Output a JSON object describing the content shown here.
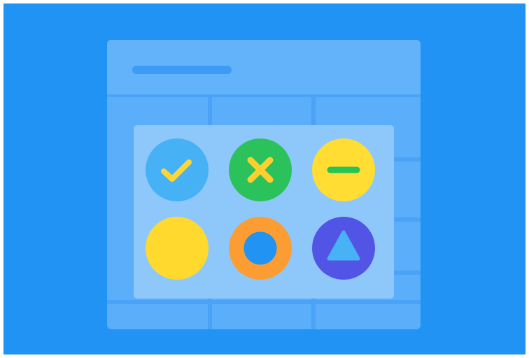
{
  "colors": {
    "frame": "#ffffff",
    "background": "#2093f4",
    "card": "#5aaefa",
    "card_header": "#63b3fb",
    "grid_lines": "#4aa3f7",
    "header_bar": "#3d9bf5",
    "panel": "#8ec8fb"
  },
  "status_icons": [
    {
      "name": "check-icon",
      "circle": "#46b1f5",
      "glyph": "#ffd633"
    },
    {
      "name": "cross-icon",
      "circle": "#2bc25c",
      "glyph": "#ffcf2e"
    },
    {
      "name": "minus-icon",
      "circle": "#ffdd33",
      "glyph": "#26c25a"
    },
    {
      "name": "solid-circle-icon",
      "circle": "#ffd92e",
      "glyph": "#ffd92e"
    },
    {
      "name": "ring-icon",
      "circle": "#fb9d33",
      "glyph": "#2193f3"
    },
    {
      "name": "triangle-icon",
      "circle": "#5254e6",
      "glyph": "#48b2f6"
    }
  ]
}
